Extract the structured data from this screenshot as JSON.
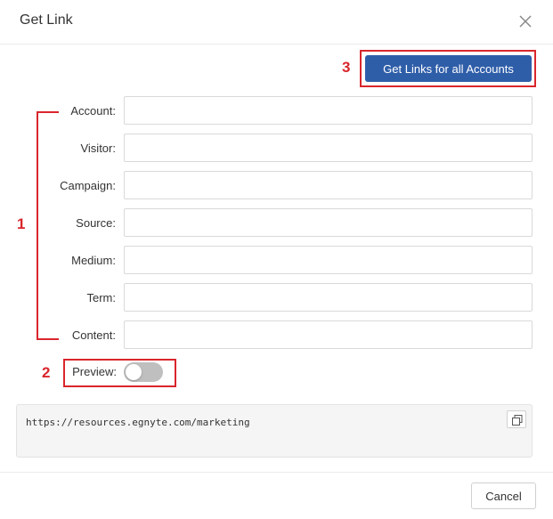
{
  "dialog": {
    "title": "Get Link",
    "close_icon": "close-icon"
  },
  "primary_action": {
    "label": "Get Links for all Accounts"
  },
  "annotations": {
    "fields_marker": "1",
    "preview_marker": "2",
    "button_marker": "3",
    "color": "#d9262c"
  },
  "fields": [
    {
      "label": "Account",
      "value": ""
    },
    {
      "label": "Visitor",
      "value": ""
    },
    {
      "label": "Campaign",
      "value": ""
    },
    {
      "label": "Source",
      "value": ""
    },
    {
      "label": "Medium",
      "value": ""
    },
    {
      "label": "Term",
      "value": ""
    },
    {
      "label": "Content",
      "value": ""
    }
  ],
  "label_separator": ":",
  "preview": {
    "label": "Preview",
    "enabled": false
  },
  "link_output": {
    "url": "https://resources.egnyte.com/marketing",
    "copy_icon": "copy-icon"
  },
  "footer": {
    "cancel_label": "Cancel"
  },
  "colors": {
    "primary": "#2f5ea9",
    "toggle_off": "#bfbfbf"
  }
}
